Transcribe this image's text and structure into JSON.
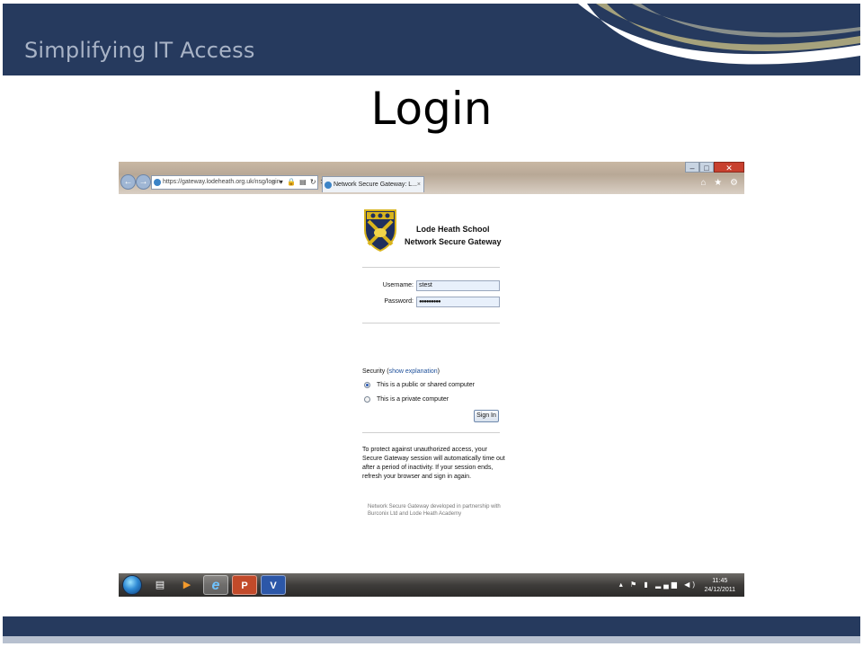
{
  "slide": {
    "header_title": "Simplifying IT Access",
    "title": "Login",
    "colors": {
      "navy": "#263a5e",
      "swoosh": "#a6a27c",
      "accent_blue": "#1d4f9a"
    }
  },
  "browser": {
    "address": "https://gateway.lodeheath.org.uk/nsg/login.",
    "tab_title": "Network Secure Gateway: L...",
    "tab_close": "×",
    "back_icon": "←",
    "forward_icon": "→",
    "address_tools": "⌕ ▾ 🔒 ▤ ↻ ✕",
    "window_min": "–",
    "window_max": "□",
    "window_close": "✕",
    "right_tools": "⌂ ★ ⚙"
  },
  "login": {
    "school_line1": "Lode Heath School",
    "school_line2": "Network Secure Gateway",
    "username_label": "Username:",
    "username_value": "stest",
    "password_label": "Password:",
    "password_value": "●●●●●●●●●",
    "security_label": "Security (",
    "security_link": "show explanation",
    "security_close": ")",
    "option_public": "This is a public or shared computer",
    "option_private": "This is a private computer",
    "selected_option": "public",
    "signin_label": "Sign In",
    "info": "To protect against unauthorized access, your Secure Gateway session will automatically time out after a period of inactivity. If your session ends, refresh your browser and sign in again.",
    "credit": "Network Secure Gateway developed in partnership with Burconix Ltd and Lode Heath Academy"
  },
  "taskbar": {
    "apps": [
      {
        "name": "explorer",
        "glyph": "▤"
      },
      {
        "name": "media-player",
        "glyph": "▶"
      },
      {
        "name": "internet-explorer",
        "glyph": "e"
      },
      {
        "name": "powerpoint",
        "glyph": "P"
      },
      {
        "name": "visio",
        "glyph": "V"
      }
    ],
    "tray": "▴ ⚑ ▮ ▂▄▆ ◀)",
    "time": "11:45",
    "date": "24/12/2011"
  }
}
